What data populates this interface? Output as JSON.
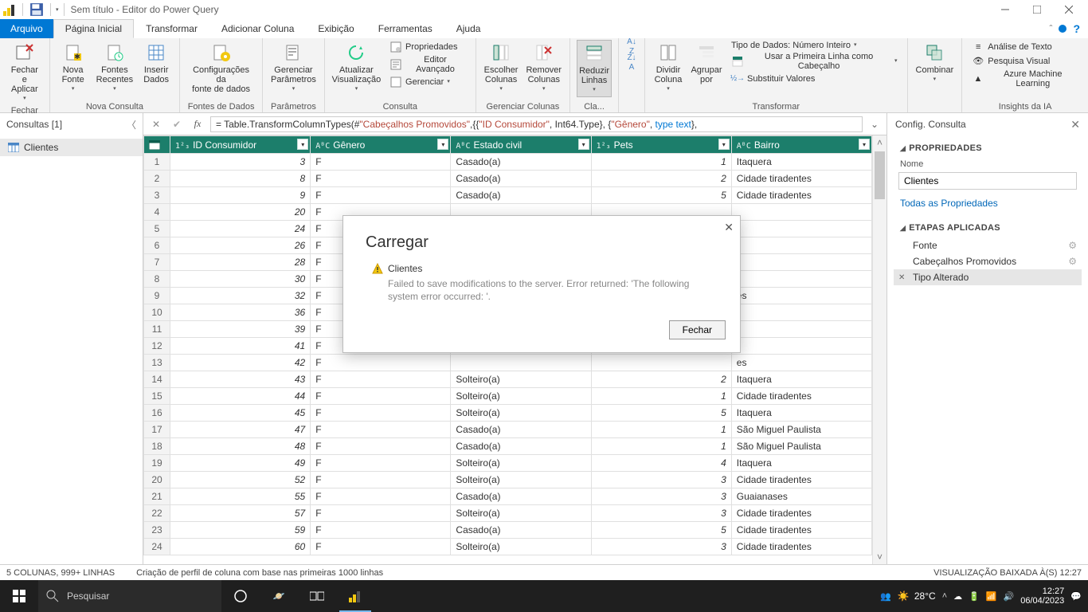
{
  "title": "Sem título - Editor do Power Query",
  "tabs": {
    "file": "Arquivo",
    "home": "Página Inicial",
    "transform": "Transformar",
    "addcol": "Adicionar Coluna",
    "view": "Exibição",
    "tools": "Ferramentas",
    "help": "Ajuda"
  },
  "ribbon": {
    "close_apply": "Fechar e\nAplicar",
    "close_group": "Fechar",
    "new_source": "Nova\nFonte",
    "recent": "Fontes\nRecentes",
    "enter_data": "Inserir\nDados",
    "newquery_group": "Nova Consulta",
    "ds_settings": "Configurações da\nfonte de dados",
    "ds_group": "Fontes de Dados",
    "manage_params": "Gerenciar\nParâmetros",
    "params_group": "Parâmetros",
    "refresh": "Atualizar\nVisualização",
    "properties": "Propriedades",
    "adv_editor": "Editor Avançado",
    "manage": "Gerenciar",
    "query_group": "Consulta",
    "choose_cols": "Escolher\nColunas",
    "remove_cols": "Remover\nColunas",
    "manage_cols_group": "Gerenciar Colunas",
    "reduce_rows": "Reduzir\nLinhas",
    "reduce_group": "Cla...",
    "split": "Dividir\nColuna",
    "groupby": "Agrupar\npor",
    "datatype_label": "Tipo de Dados: Número Inteiro",
    "first_row": "Usar a Primeira Linha como Cabeçalho",
    "replace": "Substituir Valores",
    "transform_group": "Transformar",
    "combine": "Combinar",
    "text_analytics": "Análise de Texto",
    "vision": "Pesquisa Visual",
    "azureml": "Azure Machine Learning",
    "insights_group": "Insights da IA",
    "sort_asc": "A-Z",
    "sort_desc": "Z-A"
  },
  "queries": {
    "header": "Consultas [1]",
    "item": "Clientes"
  },
  "formula": {
    "prefix": "= Table.TransformColumnTypes(#",
    "q1": "\"Cabeçalhos Promovidos\"",
    "mid": ",{{",
    "q2": "\"ID Consumidor\"",
    "t1": ", Int64.Type}, {",
    "q3": "\"Gênero\"",
    "t2": ", ",
    "kw": "type text",
    "end": "},"
  },
  "columns": [
    {
      "type": "1²₃",
      "name": "ID Consumidor"
    },
    {
      "type": "AᴮC",
      "name": "Gênero"
    },
    {
      "type": "AᴮC",
      "name": "Estado civil"
    },
    {
      "type": "1²₃",
      "name": "Pets"
    },
    {
      "type": "AᴮC",
      "name": "Bairro"
    }
  ],
  "rows": [
    {
      "n": 1,
      "id": 3,
      "g": "F",
      "ec": "Casado(a)",
      "p": 1,
      "b": "Itaquera"
    },
    {
      "n": 2,
      "id": 8,
      "g": "F",
      "ec": "Casado(a)",
      "p": 2,
      "b": "Cidade tiradentes"
    },
    {
      "n": 3,
      "id": 9,
      "g": "F",
      "ec": "Casado(a)",
      "p": 5,
      "b": "Cidade tiradentes"
    },
    {
      "n": 4,
      "id": 20,
      "g": "F",
      "ec": "",
      "p": "",
      "b": ""
    },
    {
      "n": 5,
      "id": 24,
      "g": "F",
      "ec": "",
      "p": "",
      "b": ""
    },
    {
      "n": 6,
      "id": 26,
      "g": "F",
      "ec": "",
      "p": "",
      "b": ""
    },
    {
      "n": 7,
      "id": 28,
      "g": "F",
      "ec": "",
      "p": "",
      "b": ""
    },
    {
      "n": 8,
      "id": 30,
      "g": "F",
      "ec": "",
      "p": "",
      "b": ""
    },
    {
      "n": 9,
      "id": 32,
      "g": "F",
      "ec": "",
      "p": "",
      "b": "es"
    },
    {
      "n": 10,
      "id": 36,
      "g": "F",
      "ec": "",
      "p": "",
      "b": ""
    },
    {
      "n": 11,
      "id": 39,
      "g": "F",
      "ec": "",
      "p": "",
      "b": ""
    },
    {
      "n": 12,
      "id": 41,
      "g": "F",
      "ec": "",
      "p": "",
      "b": ""
    },
    {
      "n": 13,
      "id": 42,
      "g": "F",
      "ec": "",
      "p": "",
      "b": "es"
    },
    {
      "n": 14,
      "id": 43,
      "g": "F",
      "ec": "Solteiro(a)",
      "p": 2,
      "b": "Itaquera"
    },
    {
      "n": 15,
      "id": 44,
      "g": "F",
      "ec": "Solteiro(a)",
      "p": 1,
      "b": "Cidade tiradentes"
    },
    {
      "n": 16,
      "id": 45,
      "g": "F",
      "ec": "Solteiro(a)",
      "p": 5,
      "b": "Itaquera"
    },
    {
      "n": 17,
      "id": 47,
      "g": "F",
      "ec": "Casado(a)",
      "p": 1,
      "b": "São Miguel Paulista"
    },
    {
      "n": 18,
      "id": 48,
      "g": "F",
      "ec": "Casado(a)",
      "p": 1,
      "b": "São Miguel Paulista"
    },
    {
      "n": 19,
      "id": 49,
      "g": "F",
      "ec": "Solteiro(a)",
      "p": 4,
      "b": "Itaquera"
    },
    {
      "n": 20,
      "id": 52,
      "g": "F",
      "ec": "Solteiro(a)",
      "p": 3,
      "b": "Cidade tiradentes"
    },
    {
      "n": 21,
      "id": 55,
      "g": "F",
      "ec": "Casado(a)",
      "p": 3,
      "b": "Guaianases"
    },
    {
      "n": 22,
      "id": 57,
      "g": "F",
      "ec": "Solteiro(a)",
      "p": 3,
      "b": "Cidade tiradentes"
    },
    {
      "n": 23,
      "id": 59,
      "g": "F",
      "ec": "Casado(a)",
      "p": 5,
      "b": "Cidade tiradentes"
    },
    {
      "n": 24,
      "id": 60,
      "g": "F",
      "ec": "Solteiro(a)",
      "p": 3,
      "b": "Cidade tiradentes"
    }
  ],
  "settings": {
    "header": "Config. Consulta",
    "props": "PROPRIEDADES",
    "name_label": "Nome",
    "name_value": "Clientes",
    "all_props": "Todas as Propriedades",
    "steps_title": "ETAPAS APLICADAS",
    "steps": [
      {
        "label": "Fonte",
        "gear": true
      },
      {
        "label": "Cabeçalhos Promovidos",
        "gear": true
      },
      {
        "label": "Tipo Alterado",
        "gear": false,
        "selected": true
      }
    ]
  },
  "status": {
    "left": "5 COLUNAS, 999+ LINHAS",
    "mid": "Criação de perfil de coluna com base nas primeiras 1000 linhas",
    "right": "VISUALIZAÇÃO BAIXADA À(S) 12:27"
  },
  "modal": {
    "title": "Carregar",
    "item": "Clientes",
    "error": "Failed to save modifications to the server. Error returned: 'The following system error occurred: '.",
    "close_btn": "Fechar"
  },
  "taskbar": {
    "search": "Pesquisar",
    "temp": "28°C",
    "time": "12:27",
    "date": "06/04/2023"
  }
}
